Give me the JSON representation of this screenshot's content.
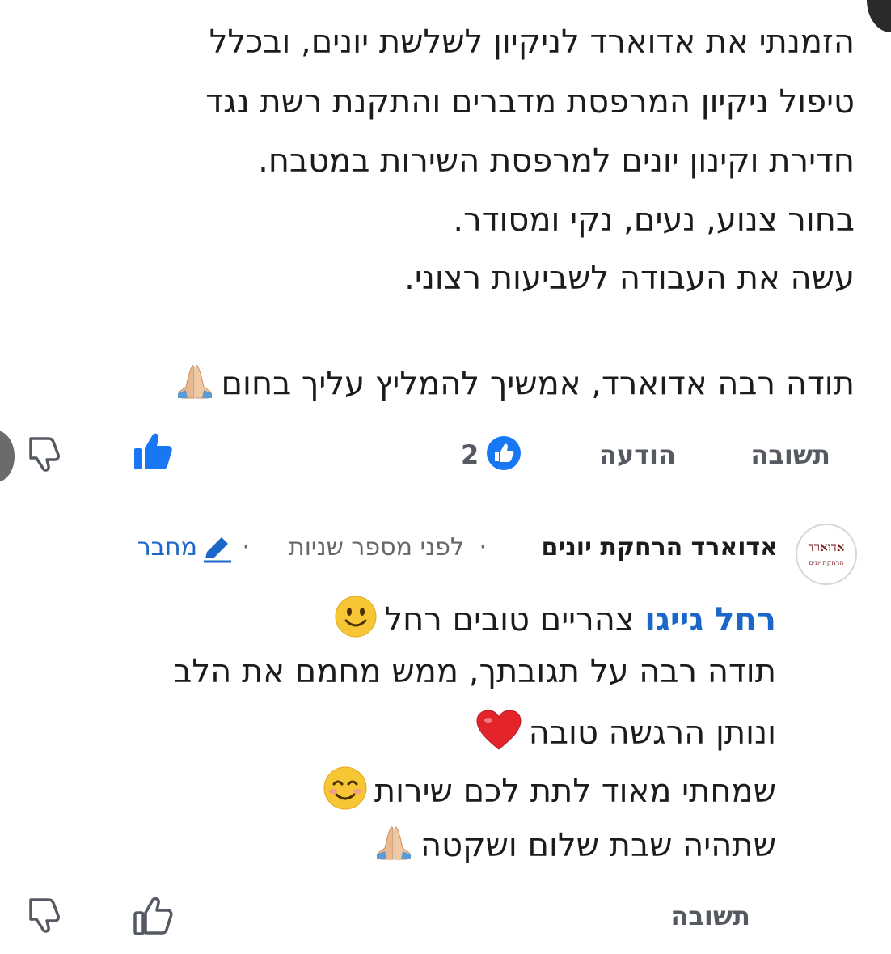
{
  "comment": {
    "lines": [
      "הזמנתי את אדוארד לניקיון לשלשת יונים, ובכלל",
      "טיפול ניקיון המרפסת מדברים והתקנת רשת נגד",
      "חדירת וקינון יונים למרפסת השירות במטבח.",
      "בחור צנוע, נעים, נקי ומסודר.",
      "עשה את העבודה לשביעות רצוני.",
      "תודה רבה אדוארד, אמשיך להמליץ עליך בחום"
    ],
    "actions": {
      "reply_label": "תשובה",
      "message_label": "הודעה",
      "like_count": "2"
    }
  },
  "reply": {
    "author_name": "אדוארד הרחקת יונים",
    "time_text": "לפני מספר שניות",
    "author_badge": "מחבר",
    "avatar": {
      "title": "אדוארד",
      "subtitle": "הרחקת יונים"
    },
    "mention": "רחל גייגו",
    "first_line_rest": "צהריים טובים רחל",
    "lines": [
      "תודה רבה על תגובתך, ממש מחמם את הלב",
      "ונותן הרגשה טובה",
      "שמחתי מאוד לתת לכם שירות",
      "שתהיה שבת שלום ושקטה"
    ],
    "actions": {
      "reply_label": "תשובה"
    }
  },
  "icons": {
    "comment_praying": "folded-hands-icon",
    "comment_dislike": "thumbs-down-icon",
    "comment_like": "thumbs-up-filled-icon",
    "like_reaction": "like-reaction-icon",
    "reply_smile": "slightly-smiling-face-icon",
    "reply_heart": "red-heart-icon",
    "reply_blush": "smiling-face-with-smiling-eyes-icon",
    "reply_praying": "folded-hands-icon",
    "reply_dislike": "thumbs-down-outline-icon",
    "reply_like": "thumbs-up-outline-icon",
    "author_pencil": "pencil-icon"
  },
  "colors": {
    "text": "#1c1c1c",
    "secondary": "#65676b",
    "action": "#555a62",
    "link_blue": "#1b66c9",
    "like_blue": "#1877f2"
  }
}
